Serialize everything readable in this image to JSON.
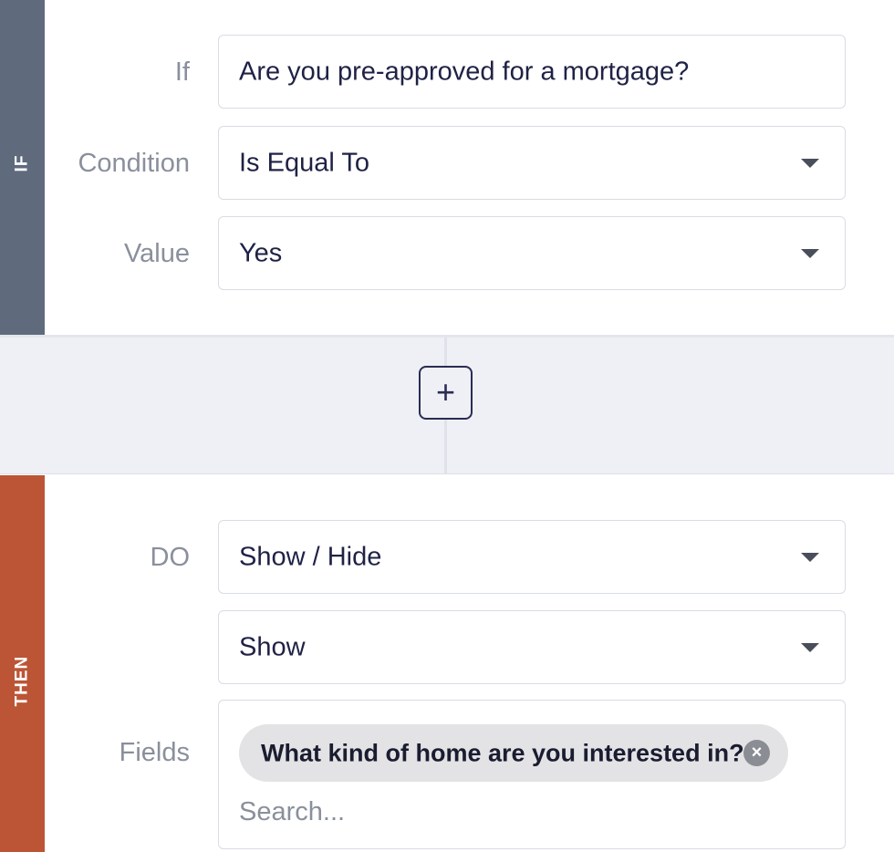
{
  "if_section": {
    "side_label": "IF",
    "rows": {
      "if": {
        "label": "If",
        "value": "Are you pre-approved for a mortgage?"
      },
      "condition": {
        "label": "Condition",
        "value": "Is Equal To"
      },
      "value": {
        "label": "Value",
        "value": "Yes"
      }
    }
  },
  "connector": {
    "add_label": "+"
  },
  "then_section": {
    "side_label": "THEN",
    "do": {
      "label": "DO",
      "value": "Show / Hide"
    },
    "visibility": {
      "value": "Show"
    },
    "fields": {
      "label": "Fields",
      "chips": [
        "What kind of home are you interested in?"
      ],
      "remove_icon": "×",
      "search_placeholder": "Search..."
    }
  },
  "colors": {
    "if_bar": "#5f6b7d",
    "then_bar": "#bb5536",
    "connector_bg": "#eef0f5",
    "text": "#1f2245"
  },
  "icons": {
    "dropdown": "caret-down-icon",
    "add": "plus-icon",
    "remove": "close-circle-icon"
  }
}
